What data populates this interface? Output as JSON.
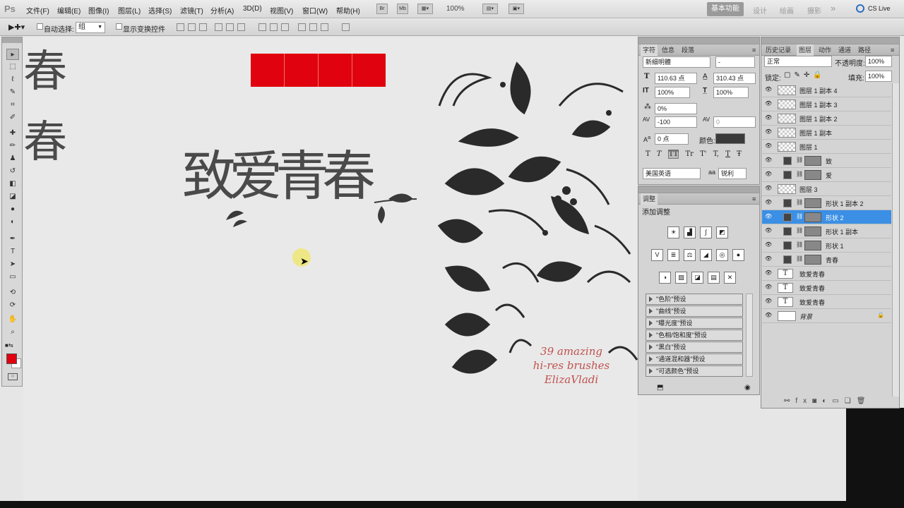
{
  "app": {
    "logo": "Ps"
  },
  "menu": [
    "文件(F)",
    "编辑(E)",
    "图像(I)",
    "图层(L)",
    "选择(S)",
    "滤镜(T)",
    "分析(A)",
    "3D(D)",
    "视图(V)",
    "窗口(W)",
    "帮助(H)"
  ],
  "menubar_buttons": {
    "br": "Br",
    "mb": "Mb",
    "zoom": "100%"
  },
  "workspaces": {
    "active": "基本功能",
    "others": [
      "设计",
      "绘画",
      "摄影"
    ],
    "more": "»",
    "cslive": "CS Live"
  },
  "options": {
    "auto_select_label": "自动选择:",
    "auto_select_value": "组",
    "show_transform_label": "显示变换控件"
  },
  "canvas": {
    "vertical_chars": [
      "春",
      "春"
    ],
    "title": "致爱青春",
    "brush_credit": [
      "39 amazing",
      "hi-res brushes",
      "ElizaVladi"
    ],
    "red_color": "#e0020e"
  },
  "character_panel": {
    "tabs": [
      "字符",
      "信息",
      "段落"
    ],
    "font": "新细明體",
    "style": "-",
    "size": "110.63 点",
    "leading": "310.43 点",
    "vscale": "100%",
    "hscale": "100%",
    "tsume": "0%",
    "tracking": "-100",
    "kerning": "0",
    "baseline": "0 点",
    "color_label": "颜色:",
    "lang": "美国英语",
    "aa_icon": "aa",
    "aa": "锐利",
    "style_buttons": [
      "T",
      "T",
      "TT",
      "Tr",
      "T'",
      "T,",
      "T",
      "Ŧ"
    ]
  },
  "adjust_panel": {
    "tab": "调整",
    "title": "添加调整",
    "presets": [
      "\"色阶\"预设",
      "\"曲线\"预设",
      "\"曝光度\"预设",
      "\"色相/饱和度\"预设",
      "\"黑白\"预设",
      "\"通道混和器\"预设",
      "\"可选颜色\"预设"
    ]
  },
  "layers_panel": {
    "tabs": [
      "历史记录",
      "图层",
      "动作",
      "通道",
      "路径"
    ],
    "blend": "正常",
    "opacity_label": "不透明度:",
    "opacity": "100%",
    "lock_label": "锁定:",
    "fill_label": "填充:",
    "fill": "100%",
    "layers": [
      {
        "name": "图层 1 副本 4",
        "kind": "pixel"
      },
      {
        "name": "图层 1 副本 3",
        "kind": "pixel"
      },
      {
        "name": "图层 1 副本 2",
        "kind": "pixel"
      },
      {
        "name": "图层 1 副本",
        "kind": "pixel"
      },
      {
        "name": "图层 1",
        "kind": "pixel"
      },
      {
        "name": "致",
        "kind": "shape"
      },
      {
        "name": "爱",
        "kind": "shape"
      },
      {
        "name": "图层 3",
        "kind": "pixel"
      },
      {
        "name": "形状 1 副本 2",
        "kind": "shape"
      },
      {
        "name": "形状 2",
        "kind": "shape",
        "selected": true
      },
      {
        "name": "形状 1 副本",
        "kind": "shape"
      },
      {
        "name": "形状 1",
        "kind": "shape"
      },
      {
        "name": "青春",
        "kind": "shape"
      },
      {
        "name": "致爱青春",
        "kind": "text"
      },
      {
        "name": "致爱青春",
        "kind": "text"
      },
      {
        "name": "致爱青春",
        "kind": "text"
      },
      {
        "name": "背景",
        "kind": "background"
      }
    ],
    "bottom_icons": [
      "link-icon",
      "fx-icon",
      "mask-icon",
      "adjustment-icon",
      "group-icon",
      "new-layer-icon",
      "trash-icon"
    ]
  },
  "tools": [
    "move",
    "marquee",
    "lasso",
    "quick-select",
    "crop",
    "eyedropper",
    "healing",
    "brush",
    "stamp",
    "history-brush",
    "eraser",
    "gradient",
    "blur",
    "dodge",
    "pen",
    "type",
    "path-select",
    "shape",
    "3d-rotate",
    "3d-orbit",
    "hand",
    "zoom"
  ],
  "colors": {
    "fg": "#e0020e",
    "bg": "#ffffff",
    "selection": "#3b8fe4"
  }
}
